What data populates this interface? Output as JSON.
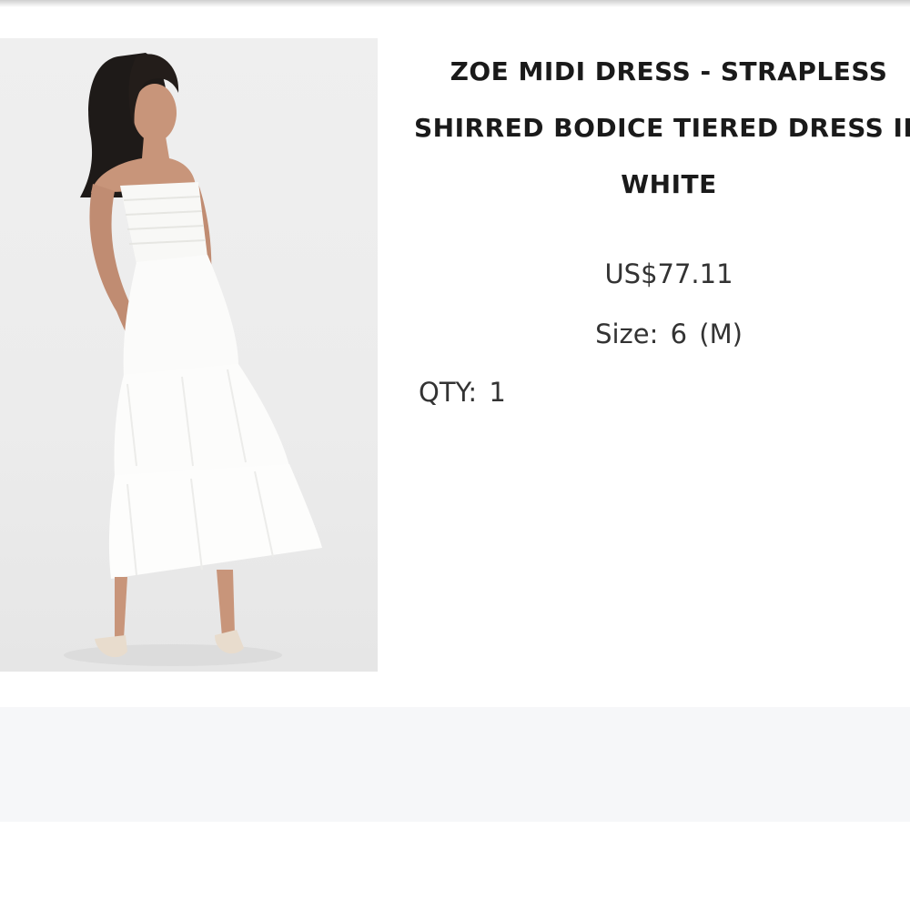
{
  "product": {
    "title_lines": [
      "ZOE MIDI DRESS - STRAPLESS",
      "SHIRRED BODICE TIERED DRESS IN",
      "WHITE"
    ],
    "price": "US$77.11",
    "size_label": "Size:",
    "size_value": "6 (M)",
    "qty_label": "QTY:",
    "qty_value": "1",
    "image_icon": "product-photo"
  }
}
